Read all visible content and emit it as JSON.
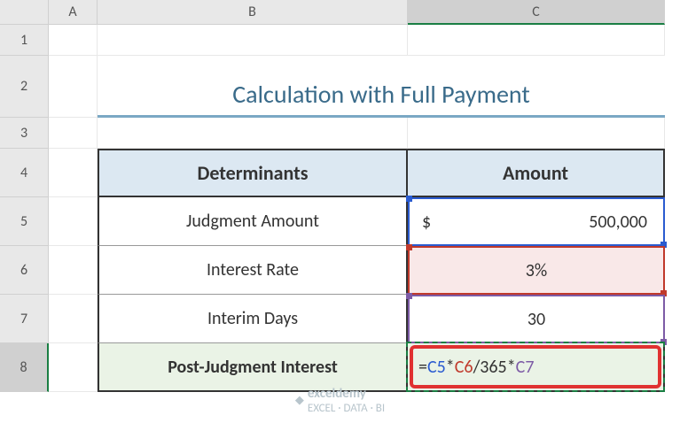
{
  "columns": {
    "a": "A",
    "b": "B",
    "c": "C"
  },
  "rows": {
    "r1": "1",
    "r2": "2",
    "r3": "3",
    "r4": "4",
    "r5": "5",
    "r6": "6",
    "r7": "7",
    "r8": "8"
  },
  "title": "Calculation with Full Payment",
  "headers": {
    "determinants": "Determinants",
    "amount": "Amount"
  },
  "labels": {
    "judgment": "Judgment Amount",
    "rate": "Interest Rate",
    "days": "Interim Days",
    "pji": "Post-Judgment Interest"
  },
  "values": {
    "currency": "$",
    "judgment": "500,000",
    "rate": "3%",
    "days": "30"
  },
  "formula": {
    "eq": "=",
    "ref1": "C5",
    "op1": "*",
    "ref2": "C6",
    "op2": "/365*",
    "ref3": "C7"
  },
  "watermark": {
    "brand": "exceldemy",
    "tag": "EXCEL · DATA · BI"
  },
  "chart_data": {
    "type": "table",
    "title": "Calculation with Full Payment",
    "columns": [
      "Determinants",
      "Amount"
    ],
    "rows": [
      [
        "Judgment Amount",
        500000
      ],
      [
        "Interest Rate",
        "3%"
      ],
      [
        "Interim Days",
        30
      ],
      [
        "Post-Judgment Interest",
        "=C5*C6/365*C7"
      ]
    ]
  }
}
